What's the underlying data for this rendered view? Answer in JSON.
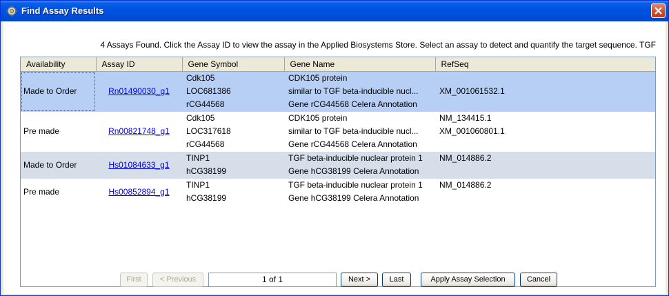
{
  "window": {
    "title": "Find Assay Results",
    "app_icon": "gear-icon",
    "close_icon": "close-icon"
  },
  "message": "4 Assays Found. Click the Assay ID to view the assay in the Applied Biosystems Store. Select an assay to detect and quantify the target sequence. TGF",
  "table": {
    "columns": [
      "Availability",
      "Assay ID",
      "Gene Symbol",
      "Gene Name",
      "RefSeq"
    ],
    "rows": [
      {
        "availability": "Made to Order",
        "assay_id": "Rn01490030_g1",
        "gene_symbol": [
          "Cdk105",
          "LOC681386",
          "rCG44568"
        ],
        "gene_name": [
          "CDK105 protein",
          "similar to TGF beta-inducible nucl...",
          "Gene rCG44568 Celera Annotation"
        ],
        "refseq": [
          "",
          "XM_001061532.1",
          ""
        ]
      },
      {
        "availability": "Pre made",
        "assay_id": "Rn00821748_g1",
        "gene_symbol": [
          "Cdk105",
          "LOC317618",
          "rCG44568"
        ],
        "gene_name": [
          "CDK105 protein",
          "similar to TGF beta-inducible nucl...",
          "Gene rCG44568 Celera Annotation"
        ],
        "refseq": [
          "NM_134415.1",
          "XM_001060801.1",
          ""
        ]
      },
      {
        "availability": "Made to Order",
        "assay_id": "Hs01084633_g1",
        "gene_symbol": [
          "TINP1",
          "hCG38199"
        ],
        "gene_name": [
          "TGF beta-inducible nuclear protein 1",
          "Gene hCG38199 Celera Annotation"
        ],
        "refseq": [
          "NM_014886.2",
          ""
        ]
      },
      {
        "availability": "Pre made",
        "assay_id": "Hs00852894_g1",
        "gene_symbol": [
          "TINP1",
          "hCG38199"
        ],
        "gene_name": [
          "TGF beta-inducible nuclear protein 1",
          "Gene hCG38199 Celera Annotation"
        ],
        "refseq": [
          "NM_014886.2",
          ""
        ]
      }
    ]
  },
  "pager": {
    "first": "First",
    "previous": "< Previous",
    "page": "1 of 1",
    "next": "Next >",
    "last": "Last"
  },
  "actions": {
    "apply": "Apply Assay Selection",
    "cancel": "Cancel"
  }
}
